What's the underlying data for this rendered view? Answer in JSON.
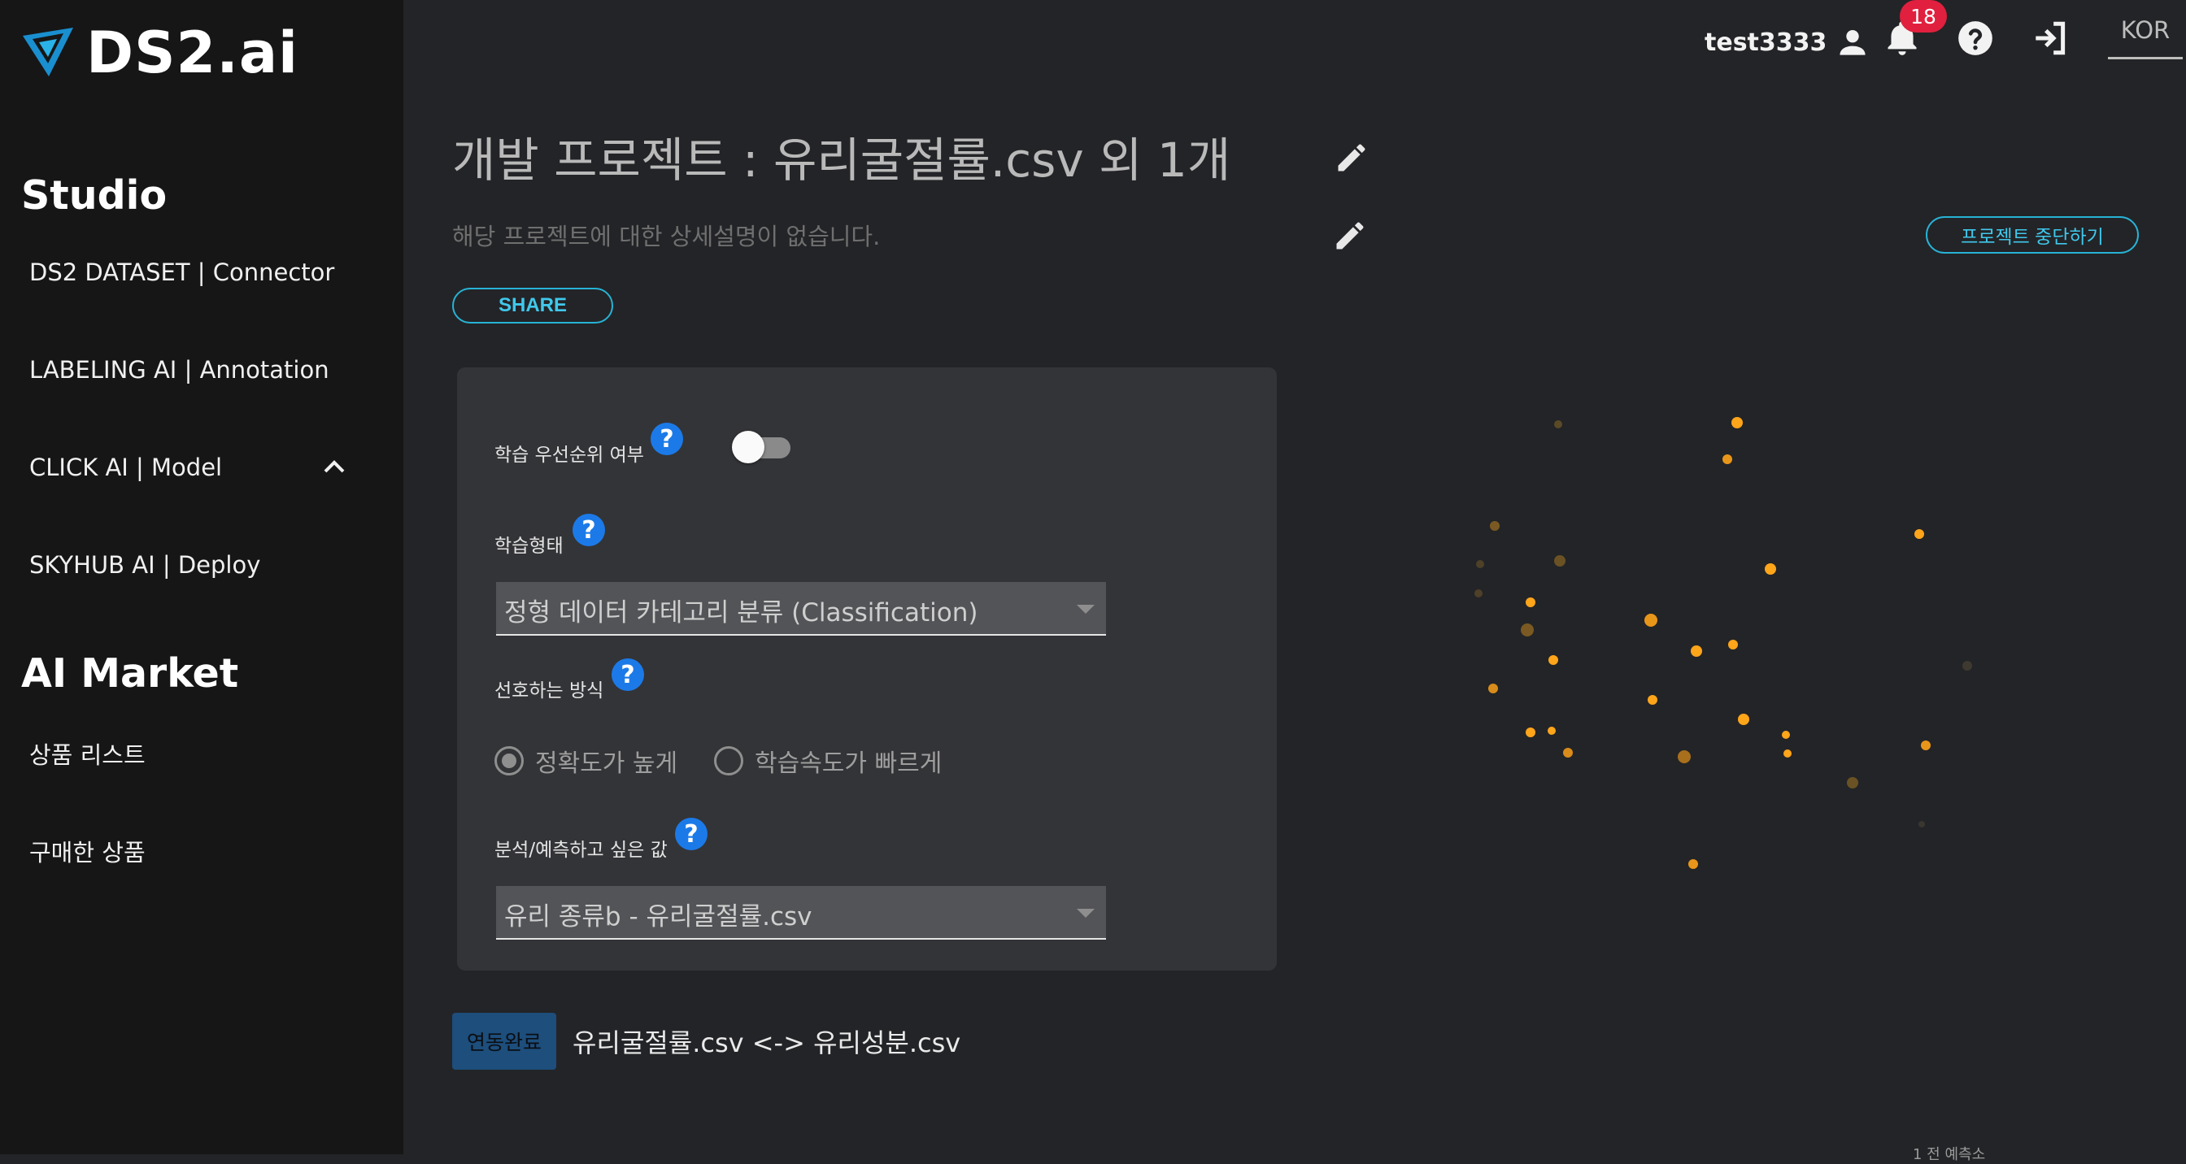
{
  "brand": {
    "name": "DS2.ai"
  },
  "sidebar": {
    "studio_title": "Studio",
    "studio_items": [
      {
        "label": "DS2 DATASET | Connector"
      },
      {
        "label": "LABELING AI | Annotation"
      },
      {
        "label": "CLICK AI | Model"
      },
      {
        "label": "SKYHUB AI | Deploy"
      }
    ],
    "market_title": "AI Market",
    "market_items": [
      {
        "label": "상품 리스트"
      },
      {
        "label": "구매한 상품"
      }
    ]
  },
  "header": {
    "username": "test3333",
    "notification_count": "18",
    "language": "KOR"
  },
  "project": {
    "title": "개발 프로젝트 : 유리굴절률.csv 외 1개",
    "description": "해당 프로젝트에 대한 상세설명이 없습니다.",
    "share_label": "SHARE",
    "stop_label": "프로젝트 중단하기"
  },
  "form": {
    "priority_label": "학습 우선순위 여부",
    "priority_enabled": false,
    "training_type_label": "학습형태",
    "training_type_value": "정형 데이터 카테고리 분류 (Classification)",
    "preference_label": "선호하는 방식",
    "preference_options": [
      {
        "label": "정확도가 높게",
        "selected": true
      },
      {
        "label": "학습속도가 빠르게",
        "selected": false
      }
    ],
    "target_label": "분석/예측하고 싶은 값",
    "target_value": "유리 종류b - 유리굴절률.csv",
    "help_symbol": "?"
  },
  "linked": {
    "badge": "연동완료",
    "text": "유리굴절률.csv <-> 유리성분.csv"
  },
  "footer": {
    "corner_text": "1 전 예측소"
  },
  "colors": {
    "accent": "#27b3d6",
    "help": "#1c7ae8",
    "badge": "#e0203e",
    "particle": "#ffa51a"
  }
}
